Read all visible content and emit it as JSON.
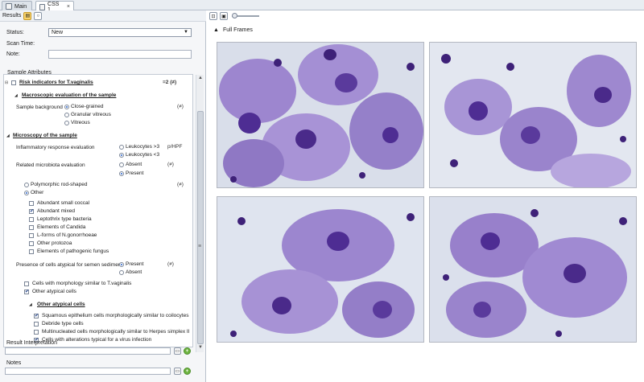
{
  "tabs": [
    {
      "label": "Main",
      "active": false
    },
    {
      "label": "CSS 1",
      "active": true,
      "close_glyph": "×"
    }
  ],
  "left": {
    "results_label": "Results",
    "status_label": "Status:",
    "status_value": "New",
    "scan_time_label": "Scan Time:",
    "note_label": "Note:",
    "sample_attributes_label": "Sample Attributes",
    "risk_title": "Risk indicators for T.vaginalis",
    "risk_score": "=2 (≠)",
    "macro_title": "Macroscopic evaluation of the sample",
    "sample_background_label": "Sample background",
    "sample_background_options": [
      "Close-grained",
      "Granular vitreous",
      "Vitreous"
    ],
    "sample_background_aux": "(≠)",
    "micro_title": "Microscopy of the sample",
    "inflammatory_label": "Inflammatory response evaluation",
    "inflammatory_options": [
      "Leukocytes >3",
      "Leukocytes <3"
    ],
    "inflammatory_aux": "p/HPF",
    "microbiota_label": "Related microbiota evaluation",
    "microbiota_options": [
      "Absent",
      "Present"
    ],
    "microbiota_aux": "(≠)",
    "morph_options": [
      "Polymorphic rod-shaped",
      "Other"
    ],
    "morph_aux": "(≠)",
    "other_checks": [
      {
        "label": "Abundant small coccal",
        "checked": false
      },
      {
        "label": "Abundant mixed",
        "checked": true
      },
      {
        "label": "Leptothrix type bacteria",
        "checked": false
      },
      {
        "label": "Elements of Candida",
        "checked": false
      },
      {
        "label": "L-forms of N.gonorrhoeae",
        "checked": false
      },
      {
        "label": "Other protozoa",
        "checked": false
      },
      {
        "label": "Elements of pathogenic fungus",
        "checked": false
      }
    ],
    "atypical_label": "Presence of cells atypical for semen sediment",
    "atypical_options": [
      "Present",
      "Absent"
    ],
    "atypical_aux": "(≠)",
    "cells_checks": [
      {
        "label": "Cells with morphology similar to T.vaginalis",
        "checked": false
      },
      {
        "label": "Other atypical cells",
        "checked": true
      }
    ],
    "other_atypical_title": "Other atypical cells",
    "other_atypical_checks": [
      {
        "label": "Squamous epithelium cells morphologically similar to coilocytes",
        "checked": true
      },
      {
        "label": "Debride type cells",
        "checked": false
      },
      {
        "label": "Multinucleated cells morphologically similar to Herpes simplex II",
        "checked": false
      },
      {
        "label": "Cells with alterations typical for a virus infection",
        "checked": true
      }
    ],
    "result_interpretation_label": "Result Interpretation",
    "notes_label": "Notes",
    "check_glyph": "✔",
    "add_glyph": "+",
    "doc_glyph": "▭",
    "select_arrow": "▼",
    "scroll_up": "▲",
    "scroll_down": "▼",
    "splitter_glyph": "≡"
  },
  "right": {
    "frames_label": "Full Frames",
    "frames_toggle": "▲"
  },
  "colors": {
    "cell_purple": "#8e6fc4",
    "nucleus": "#4a2a8a",
    "background_light": "#dfe4ef",
    "accent_blue": "#2a62c9"
  },
  "icons": [
    "results-icon",
    "info-icon",
    "zoom-fit-icon",
    "zoom-image-icon",
    "checkbox-icon",
    "radio-icon",
    "document-icon",
    "add-icon"
  ]
}
